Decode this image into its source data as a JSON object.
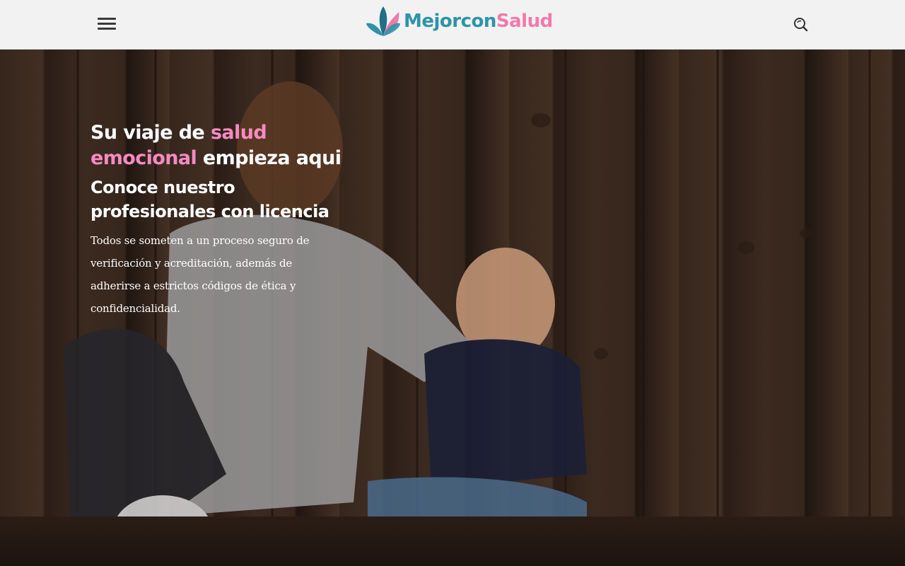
{
  "header": {
    "menu_icon": "hamburger-menu-icon",
    "logo": {
      "part1": "Mejor",
      "part2": "con",
      "part3": "Salud"
    },
    "search_icon": "search-icon"
  },
  "hero": {
    "headline": {
      "part1": "Su viaje de ",
      "highlight1": "salud",
      "highlight2": "emocional",
      "part2": " empieza aqui"
    },
    "subheadline": "Conoce nuestro profesionales con licencia",
    "description": "Todos se someten a un proceso seguro de verificación y acreditación, además de adherirse a estrictos códigos de ética y confidencialidad."
  },
  "colors": {
    "brand_teal": "#2e93a8",
    "brand_pink": "#f07aac",
    "highlight_pink": "#f58ac0",
    "header_bg": "#f2f2f2"
  }
}
